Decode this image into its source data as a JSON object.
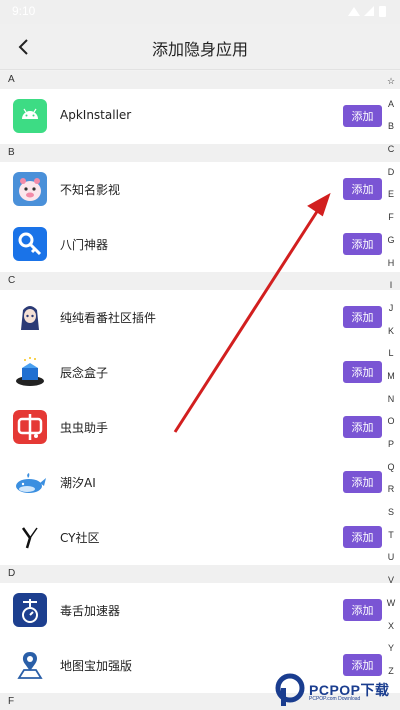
{
  "status_bar": {
    "time": "9:10"
  },
  "header": {
    "title": "添加隐身应用"
  },
  "sections": {
    "a": {
      "letter": "A",
      "apps": [
        {
          "name": "ApkInstaller",
          "button": "添加"
        }
      ]
    },
    "b": {
      "letter": "B",
      "apps": [
        {
          "name": "不知名影视",
          "button": "添加"
        },
        {
          "name": "八门神器",
          "button": "添加"
        }
      ]
    },
    "c": {
      "letter": "C",
      "apps": [
        {
          "name": "纯纯看番社区插件",
          "button": "添加"
        },
        {
          "name": "辰念盒子",
          "button": "添加"
        },
        {
          "name": "虫虫助手",
          "button": "添加"
        },
        {
          "name": "潮汐AI",
          "button": "添加"
        },
        {
          "name": "CY社区",
          "button": "添加"
        }
      ]
    },
    "d": {
      "letter": "D",
      "apps": [
        {
          "name": "毒舌加速器",
          "button": "添加"
        },
        {
          "name": "地图宝加强版",
          "button": "添加"
        }
      ]
    },
    "f": {
      "letter": "F"
    }
  },
  "index_bar": [
    "☆",
    "A",
    "B",
    "C",
    "D",
    "E",
    "F",
    "G",
    "H",
    "I",
    "J",
    "K",
    "L",
    "M",
    "N",
    "O",
    "P",
    "Q",
    "R",
    "S",
    "T",
    "U",
    "V",
    "W",
    "X",
    "Y",
    "Z"
  ],
  "watermark": {
    "text": "PCPOP下载",
    "subtext": "PCPOP.com Download"
  },
  "colors": {
    "button": "#7a55d4",
    "arrow": "#d21f1f"
  }
}
